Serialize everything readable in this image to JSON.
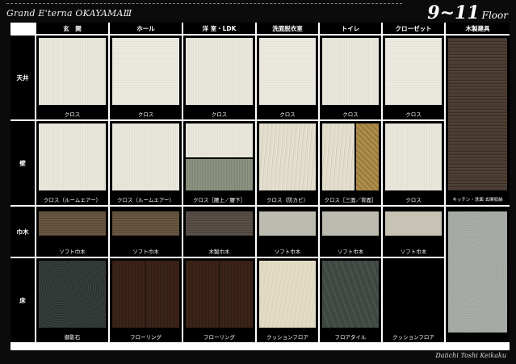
{
  "header": {
    "brand": "Grand E'terna OKAYAMAⅢ",
    "floor_number": "9~11",
    "floor_label": "Floor"
  },
  "columns": [
    "玄　関",
    "ホール",
    "洋 室・LDK",
    "洗面脱衣室",
    "トイレ",
    "クローゼット",
    "木製建具"
  ],
  "rows": [
    "天井",
    "壁",
    "巾木",
    "床"
  ],
  "captions": {
    "ceiling": [
      "クロス",
      "クロス",
      "クロス",
      "クロス",
      "クロス",
      "クロス"
    ],
    "wall": [
      "クロス（ルームエアー）",
      "クロス（ルームエアー）",
      "クロス［腰上／腰下］",
      "クロス（防カビ）",
      "クロス［三面／背面］",
      "クロス"
    ],
    "baseboard": [
      "ソフト巾木",
      "ソフト巾木",
      "木製巾木",
      "ソフト巾木",
      "ソフト巾木",
      "ソフト巾木"
    ],
    "floor": [
      "御影石",
      "フローリング",
      "フローリング",
      "クッションフロア",
      "フロアタイル",
      "クッションフロア"
    ],
    "fittings": "キッチン・洗面 玄関収納"
  },
  "footer": "Daiichi Toshi Keikaku"
}
